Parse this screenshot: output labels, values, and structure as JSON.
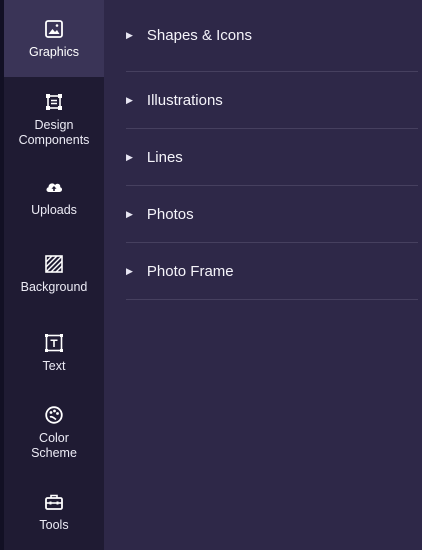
{
  "sidebar": {
    "items": [
      {
        "label": "Graphics",
        "icon": "image-icon",
        "active": true
      },
      {
        "label": "Design\nComponents",
        "icon": "components-icon",
        "active": false
      },
      {
        "label": "Uploads",
        "icon": "cloud-upload-icon",
        "active": false
      },
      {
        "label": "Background",
        "icon": "background-pattern-icon",
        "active": false
      },
      {
        "label": "Text",
        "icon": "text-icon",
        "active": false
      },
      {
        "label": "Color\nScheme",
        "icon": "palette-icon",
        "active": false
      },
      {
        "label": "Tools",
        "icon": "toolbox-icon",
        "active": false
      }
    ]
  },
  "panel": {
    "sections": [
      {
        "label": "Shapes & Icons"
      },
      {
        "label": "Illustrations"
      },
      {
        "label": "Lines"
      },
      {
        "label": "Photos"
      },
      {
        "label": "Photo Frame"
      }
    ]
  },
  "colors": {
    "rail_bg": "#1f1b33",
    "rail_active": "#3a3457",
    "panel_bg": "#2e2848",
    "divider": "#46405f"
  }
}
